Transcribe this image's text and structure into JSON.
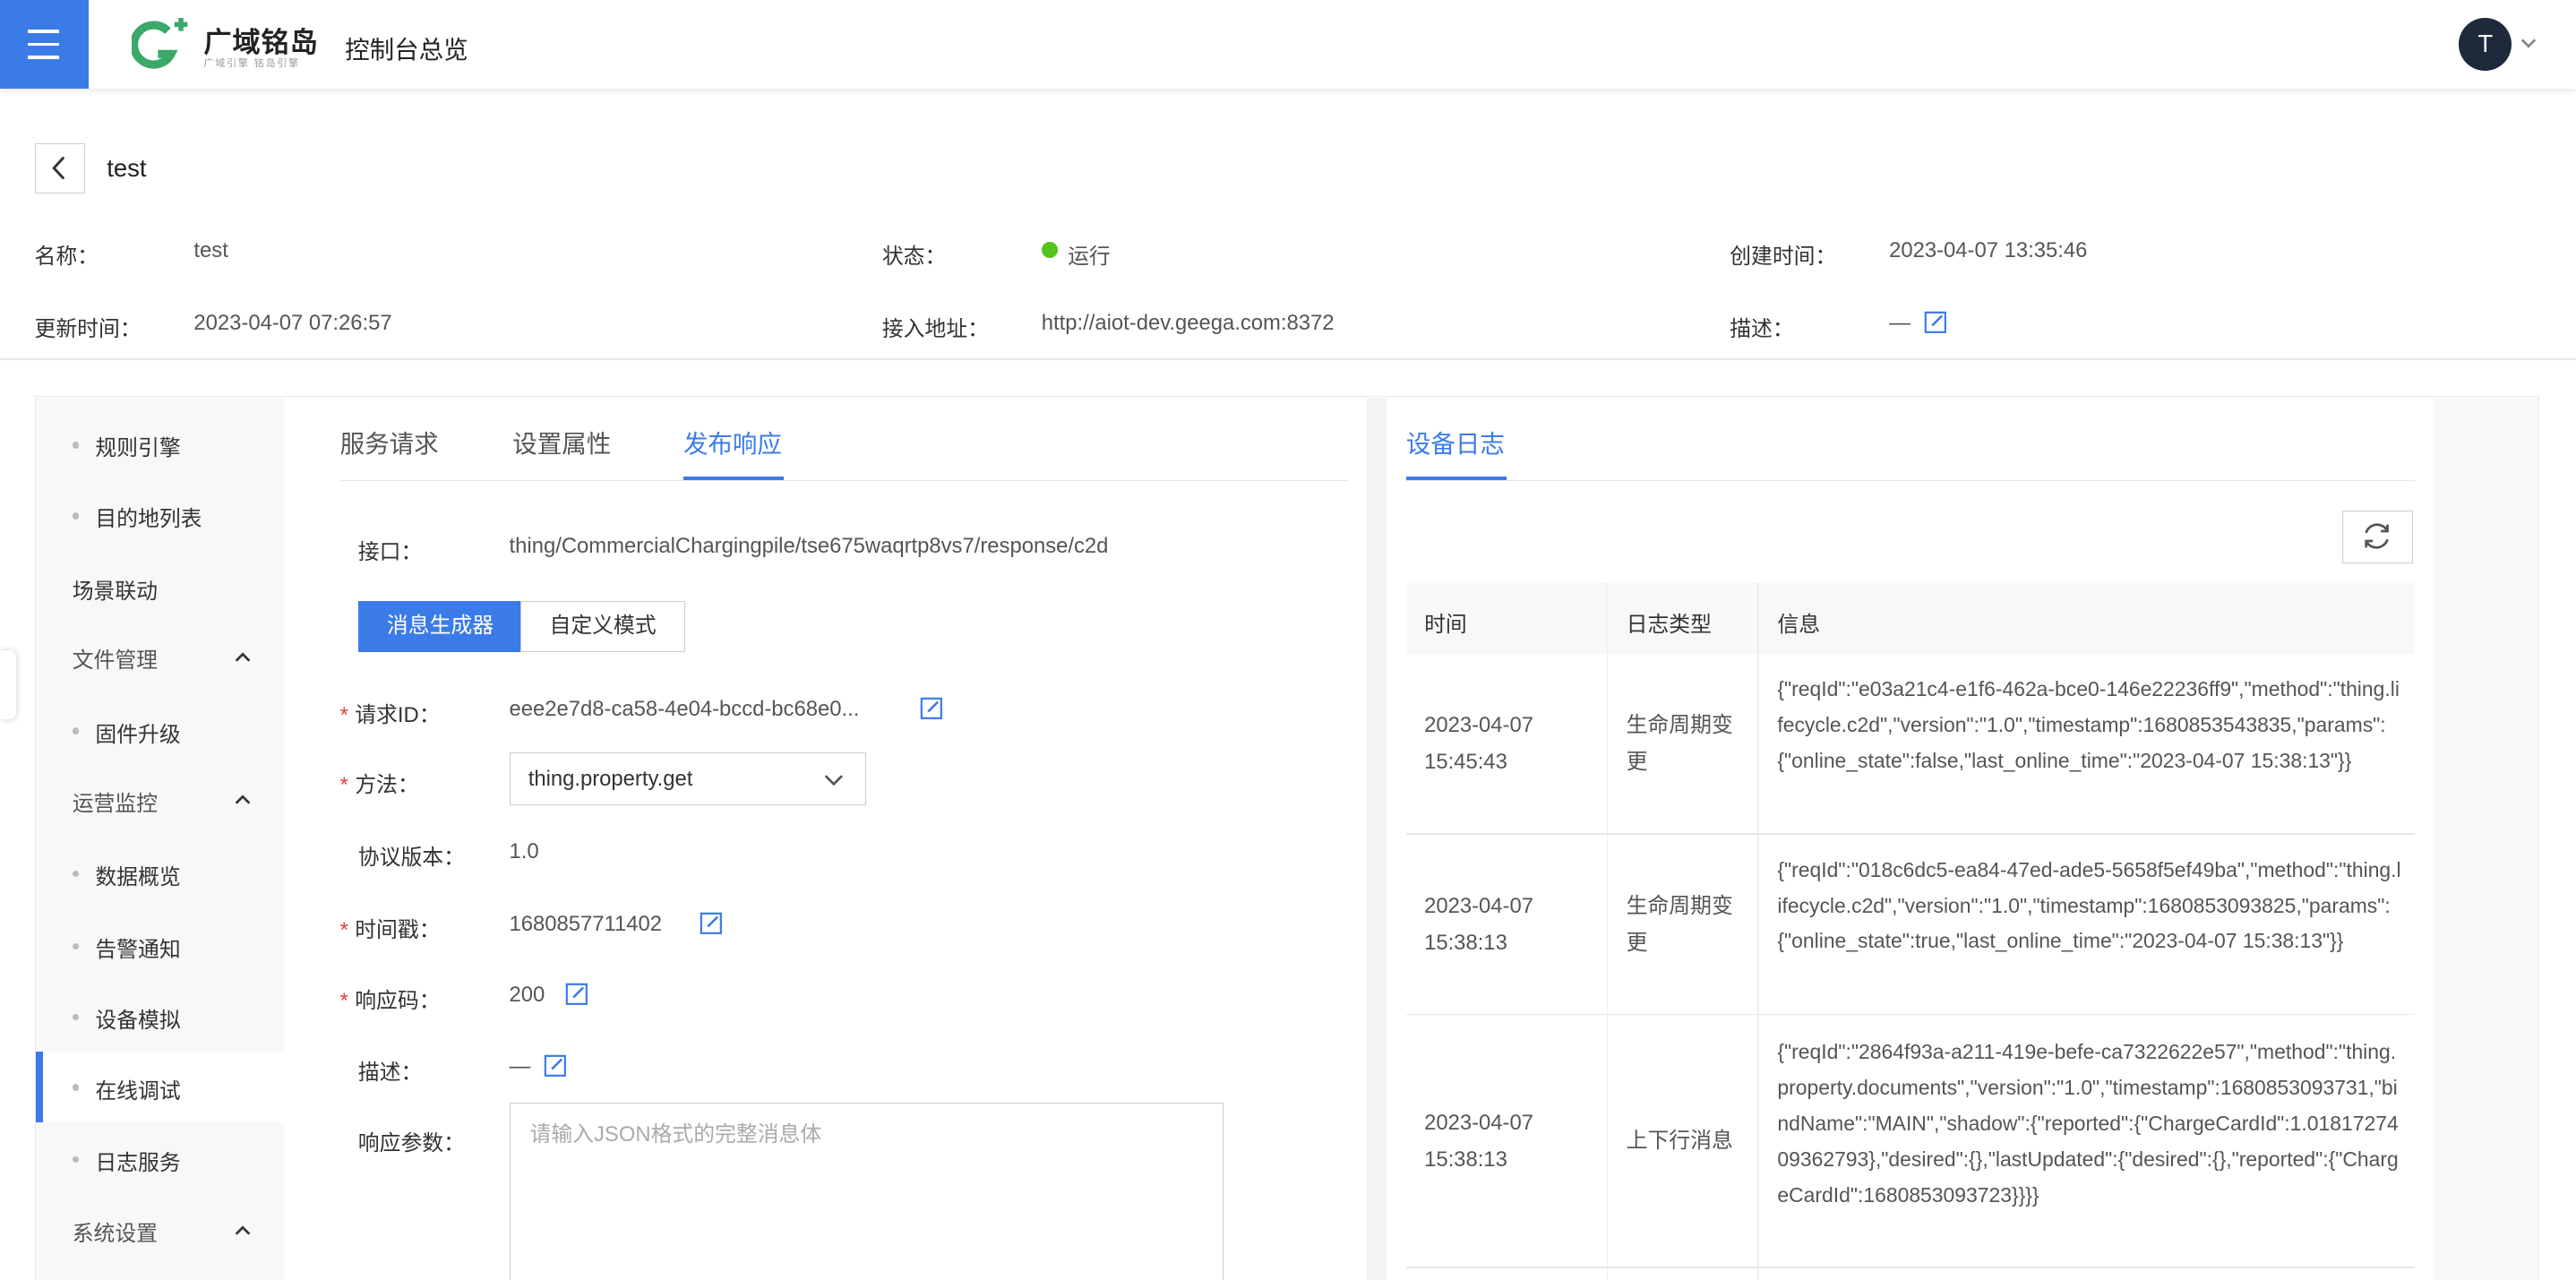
{
  "header": {
    "brand_name": "广域铭岛",
    "brand_tagline": "广域引擎 铭岛引擎",
    "nav_title": "控制台总览",
    "avatar_letter": "T"
  },
  "page": {
    "title": "test"
  },
  "details": {
    "name_label": "名称：",
    "name_value": "test",
    "status_label": "状态：",
    "status_value": "运行",
    "created_label": "创建时间：",
    "created_value": "2023-04-07 13:35:46",
    "updated_label": "更新时间：",
    "updated_value": "2023-04-07 07:26:57",
    "endpoint_label": "接入地址：",
    "endpoint_value": "http://aiot-dev.geega.com:8372",
    "desc_label": "描述：",
    "desc_value": "—"
  },
  "sidebar": {
    "items": [
      {
        "label": "规则引擎",
        "type": "child"
      },
      {
        "label": "目的地列表",
        "type": "child"
      },
      {
        "label": "场景联动",
        "type": "top"
      },
      {
        "label": "文件管理",
        "type": "group"
      },
      {
        "label": "固件升级",
        "type": "child"
      },
      {
        "label": "运营监控",
        "type": "group"
      },
      {
        "label": "数据概览",
        "type": "child"
      },
      {
        "label": "告警通知",
        "type": "child"
      },
      {
        "label": "设备模拟",
        "type": "child"
      },
      {
        "label": "在线调试",
        "type": "child",
        "active": true
      },
      {
        "label": "日志服务",
        "type": "child"
      },
      {
        "label": "系统设置",
        "type": "group"
      }
    ]
  },
  "tabs": {
    "service_request": "服务请求",
    "set_property": "设置属性",
    "publish_response": "发布响应"
  },
  "form": {
    "topic_label": "接口：",
    "topic_value": "thing/CommercialChargingpile/tse675waqrtp8vs7/response/c2d",
    "mode_generator": "消息生成器",
    "mode_custom": "自定义模式",
    "request_id_label": "请求ID：",
    "request_id_value": "eee2e7d8-ca58-4e04-bccd-bc68e0...",
    "method_label": "方法：",
    "method_value": "thing.property.get",
    "version_label": "协议版本：",
    "version_value": "1.0",
    "timestamp_label": "时间戳：",
    "timestamp_value": "1680857711402",
    "code_label": "响应码：",
    "code_value": "200",
    "desc_label": "描述：",
    "desc_value": "—",
    "params_label": "响应参数：",
    "params_placeholder": "请输入JSON格式的完整消息体"
  },
  "log": {
    "title": "设备日志",
    "columns": [
      "时间",
      "日志类型",
      "信息"
    ],
    "rows": [
      {
        "time": "2023-04-07 15:45:43",
        "type": "生命周期变更",
        "info": "{\"reqId\":\"e03a21c4-e1f6-462a-bce0-146e22236ff9\",\"method\":\"thing.lifecycle.c2d\",\"version\":\"1.0\",\"timestamp\":1680853543835,\"params\":{\"online_state\":false,\"last_online_time\":\"2023-04-07 15:38:13\"}}"
      },
      {
        "time": "2023-04-07 15:38:13",
        "type": "生命周期变更",
        "info": "{\"reqId\":\"018c6dc5-ea84-47ed-ade5-5658f5ef49ba\",\"method\":\"thing.lifecycle.c2d\",\"version\":\"1.0\",\"timestamp\":1680853093825,\"params\":{\"online_state\":true,\"last_online_time\":\"2023-04-07 15:38:13\"}}"
      },
      {
        "time": "2023-04-07 15:38:13",
        "type": "上下行消息",
        "info": "{\"reqId\":\"2864f93a-a211-419e-befe-ca7322622e57\",\"method\":\"thing.property.documents\",\"version\":\"1.0\",\"timestamp\":1680853093731,\"bindName\":\"MAIN\",\"shadow\":{\"reported\":{\"ChargeCardId\":1.0181727409362793},\"desired\":{},\"lastUpdated\":{\"desired\":{},\"reported\":{\"ChargeCardId\":1680853093723}}}}"
      }
    ]
  },
  "colors": {
    "accent": "#3b7be8",
    "status_ok": "#52c41a",
    "required": "#e23e3e"
  }
}
